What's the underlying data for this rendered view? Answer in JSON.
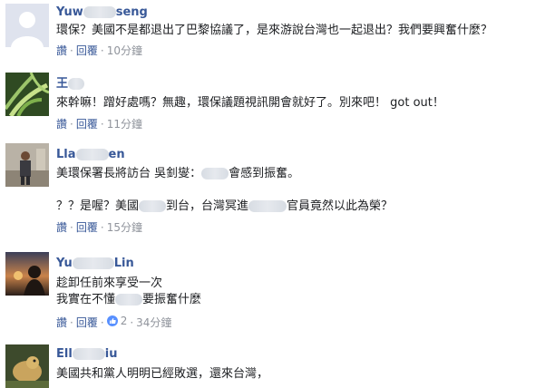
{
  "comments": [
    {
      "name_start": "Yuw",
      "name_end": "seng",
      "lines": [
        "環保？美國不是都退出了巴黎協議了，是來游說台灣也一起退出？我們要興奮什麼？"
      ],
      "like": "讚",
      "reply": "回覆",
      "time": "10分鐘"
    },
    {
      "name_start": "王",
      "name_end": "",
      "lines": [
        "來幹嘛！蹭好處嗎？無趣，環保議題視訊開會就好了。別來吧！ got out！"
      ],
      "like": "讚",
      "reply": "回覆",
      "time": "11分鐘"
    },
    {
      "name_start": "Lla",
      "name_end": "en",
      "line1_a": "美環保署長將訪台 吳釗燮：",
      "line1_b": "會感到振奮。",
      "line2_a": "？？是喔？美國",
      "line2_b": "到台，台灣冥進",
      "line2_c": "官員竟然以此為榮？",
      "like": "讚",
      "reply": "回覆",
      "time": "15分鐘"
    },
    {
      "name_start": "Yu",
      "name_end": "Lin",
      "line1": "趁卸任前來享受一次",
      "line2_a": "我實在不懂",
      "line2_b": "要振奮什麼",
      "like": "讚",
      "reply": "回覆",
      "reactions": "2",
      "time": "34分鐘"
    },
    {
      "name_start": "Ell",
      "name_end": "iu",
      "lines": [
        "美國共和黨人明明已經敗選，還來台灣，"
      ]
    }
  ],
  "colors": {
    "link": "#385898",
    "meta": "#90949c",
    "like_badge": "#5890ff"
  }
}
